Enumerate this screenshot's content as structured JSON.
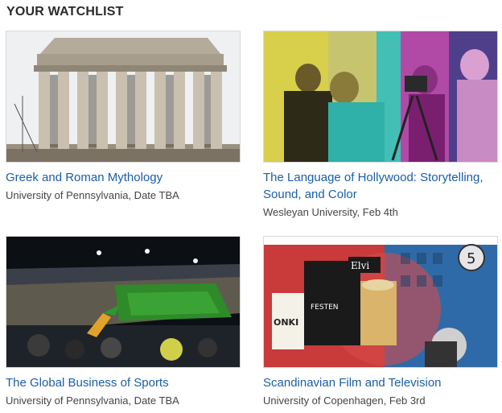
{
  "watchlist": {
    "heading": "YOUR WATCHLIST",
    "courses": [
      {
        "title": "Greek and Roman Mythology",
        "subtitle": "University of Pennsylvania, Date TBA",
        "image": "parthenon-photo"
      },
      {
        "title": "The Language of Hollywood: Storytelling, Sound, and Color",
        "subtitle": "Wesleyan University, Feb 4th",
        "image": "colorized-film-still"
      },
      {
        "title": "The Global Business of Sports",
        "subtitle": "University of Pennsylvania, Date TBA",
        "image": "stadium-photo"
      },
      {
        "title": "Scandinavian Film and Television",
        "subtitle": "University of Copenhagen, Feb 3rd",
        "image": "film-collage",
        "image_text": {
          "countdown": "5",
          "poster_main": "FESTEN",
          "poster_side": "Elvi",
          "poster_left": "ONKI"
        }
      }
    ],
    "colors": {
      "link": "#1a5ea8",
      "heading": "#2b2b2b",
      "subtitle": "#444444"
    }
  }
}
